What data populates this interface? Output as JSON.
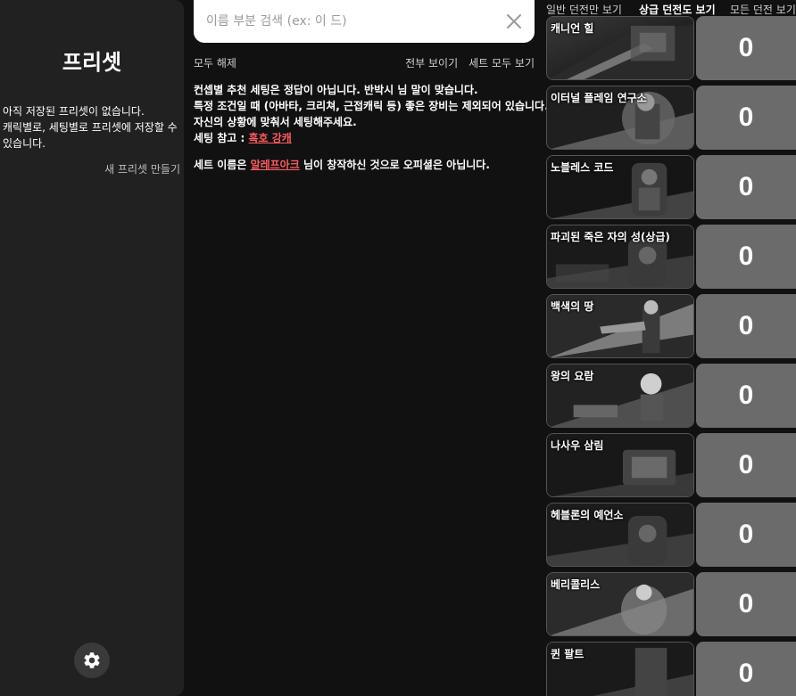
{
  "sidebar": {
    "title": "프리셋",
    "empty_lines": [
      "아직 저장된 프리셋이 없습니다.",
      "캐릭별로, 세팅별로 프리셋에 저장할 수",
      "있습니다."
    ],
    "new_preset": "새 프리셋 만들기",
    "settings_icon": "gear-icon"
  },
  "search": {
    "placeholder": "이름 부분 검색 (ex: 이 드)",
    "value": "",
    "clear_icon": "close-icon"
  },
  "toolbar": {
    "deselect_all": "모두 해제",
    "show_all": "전부 보이기",
    "show_all_sets": "세트 모두 보기"
  },
  "notice": {
    "line1": "컨셉별 추천 세팅은 정답이 아닙니다. 반박시 님 말이 맞습니다.",
    "line2": "특정 조건일 때 (아바타, 크리쳐, 근접캐릭 등) 좋은 장비는 제외되어 있습니다.",
    "line3": "자신의 상황에 맞춰서 세팅해주세요.",
    "ref_label": "세팅 참고 : ",
    "ref_link": "흑호 강캐",
    "set_prefix": "세트 이름은 ",
    "set_link": "알레프아크",
    "set_suffix": " 님이 창작하신 것으로 오피셜은 아닙니다."
  },
  "tabs": {
    "normal": "일반 던전만 보기",
    "upper": "상급 던전도 보기",
    "all": "모든 던전 보기",
    "active": "upper"
  },
  "dungeons": [
    {
      "name": "캐니언 힐",
      "count": "0"
    },
    {
      "name": "이터널 플레임 연구소",
      "count": "0"
    },
    {
      "name": "노블레스 코드",
      "count": "0"
    },
    {
      "name": "파괴된 죽은 자의 성(상급)",
      "count": "0"
    },
    {
      "name": "백색의 땅",
      "count": "0"
    },
    {
      "name": "왕의 요람",
      "count": "0"
    },
    {
      "name": "나사우 삼림",
      "count": "0"
    },
    {
      "name": "헤블론의 예언소",
      "count": "0"
    },
    {
      "name": "베리콜리스",
      "count": "0"
    },
    {
      "name": "퀸 팔트",
      "count": "0"
    }
  ],
  "colors": {
    "background": "#111111",
    "panel": "#212121",
    "count_bg": "#6b6b6b",
    "link": "#ff5a5f"
  }
}
